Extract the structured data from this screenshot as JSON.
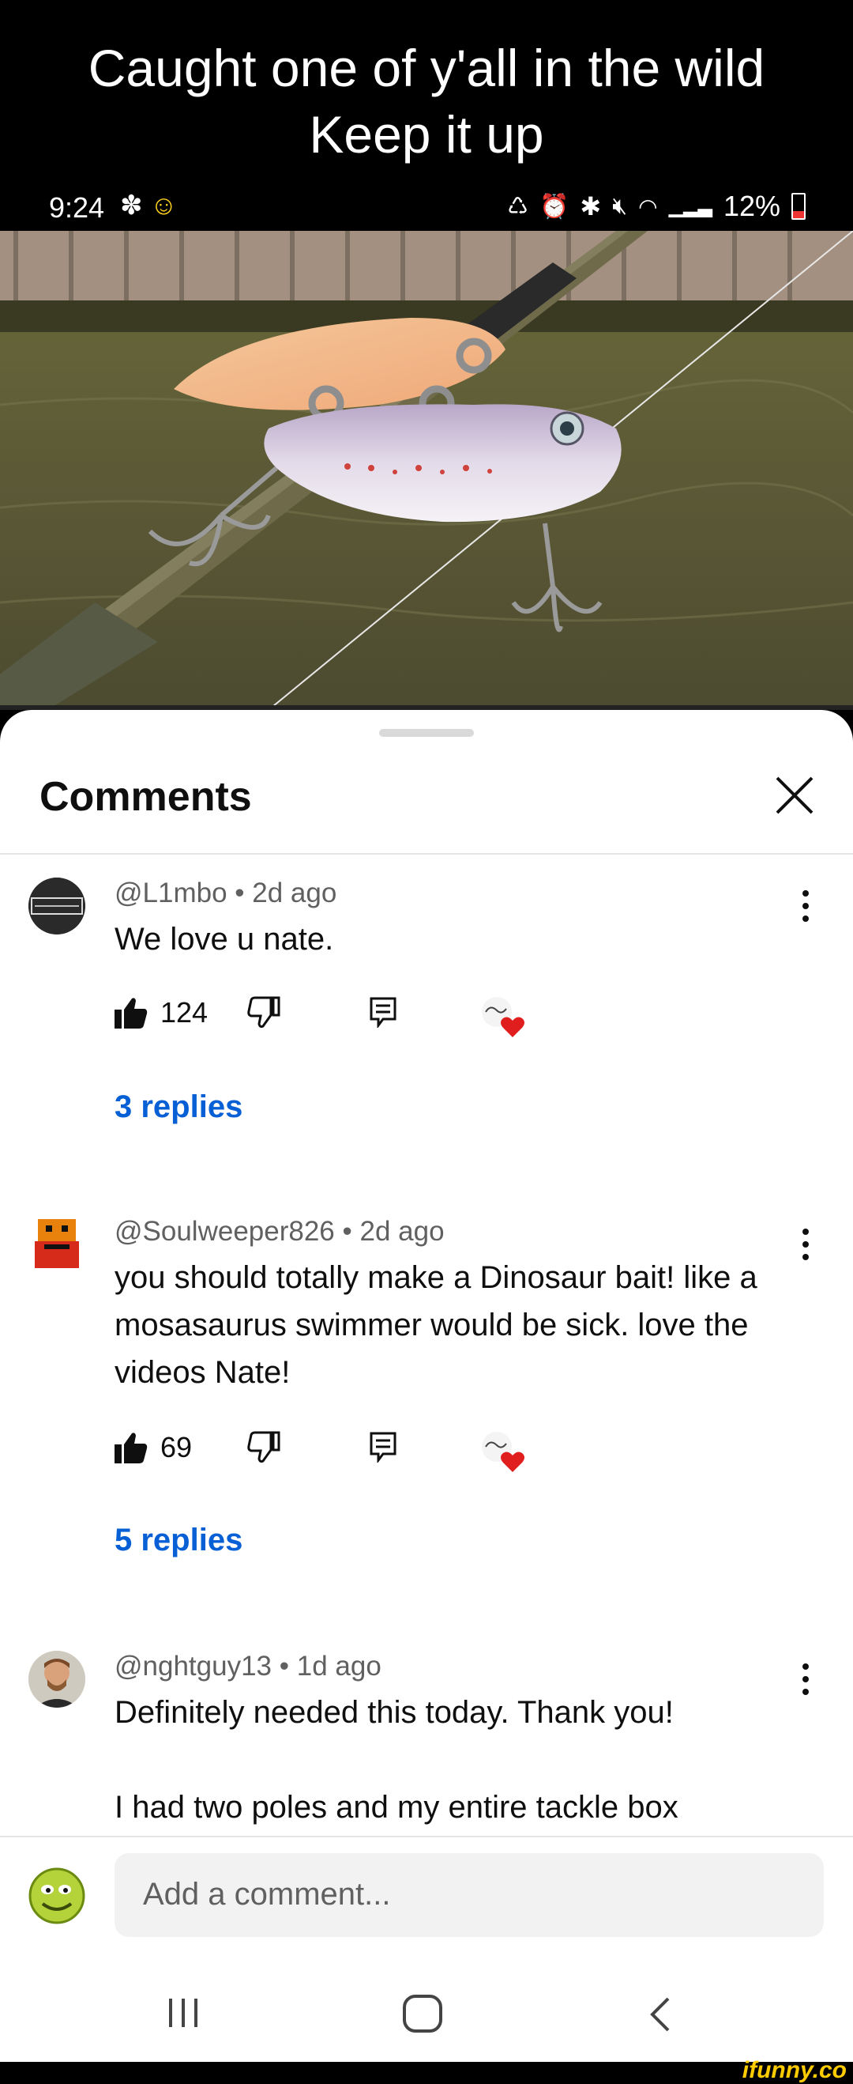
{
  "caption": {
    "line1": "Caught one of y'all in the wild",
    "line2": "Keep it up"
  },
  "status_bar": {
    "time": "9:24",
    "battery": "12%"
  },
  "sheet": {
    "title": "Comments"
  },
  "comments": [
    {
      "handle": "@L1mbo",
      "age": "2d ago",
      "text": "We love u nate.",
      "likes": "124",
      "replies": "3 replies"
    },
    {
      "handle": "@Soulweeper826",
      "age": "2d ago",
      "text": "you should totally make a Dinosaur bait! like a mosasaurus swimmer would be sick. love the videos Nate!",
      "likes": "69",
      "replies": "5 replies"
    },
    {
      "handle": "@nghtguy13",
      "age": "1d ago",
      "text_line1": "Definitely needed this today. Thank you!",
      "text_line2": "I had two poles and my entire tackle box"
    }
  ],
  "composer": {
    "placeholder": "Add a comment..."
  },
  "watermark": "ifunny.co",
  "colors": {
    "link": "#065fd4",
    "heart": "#e01e1e"
  }
}
